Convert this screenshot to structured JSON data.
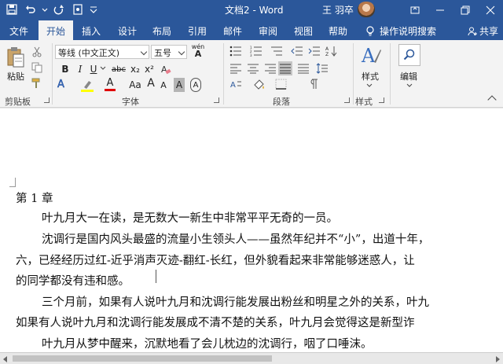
{
  "titlebar": {
    "title": "文档2 - Word",
    "user": "王 羽卒",
    "bg": "#2b579a"
  },
  "tabs": [
    {
      "label": "文件"
    },
    {
      "label": "开始"
    },
    {
      "label": "插入"
    },
    {
      "label": "设计"
    },
    {
      "label": "布局"
    },
    {
      "label": "引用"
    },
    {
      "label": "邮件"
    },
    {
      "label": "审阅"
    },
    {
      "label": "视图"
    },
    {
      "label": "帮助"
    }
  ],
  "tellme": "操作说明搜索",
  "share": "共享",
  "ribbon": {
    "clipboard": {
      "paste": "粘贴",
      "label": "剪贴板"
    },
    "font": {
      "name": "等线 (中文正文)",
      "size": "五号",
      "wen": "wén",
      "wen_a": "A",
      "label": "字体",
      "bold": "B",
      "italic": "I",
      "underline": "U",
      "strike": "abc",
      "sub": "x₂",
      "sup": "x²",
      "font_color": "A",
      "case": "Aa",
      "grow": "A",
      "shrink": "A",
      "char_shading": "A",
      "enclose": "A"
    },
    "paragraph": {
      "label": "段落"
    },
    "styles": {
      "btn": "样式",
      "label": "样式"
    },
    "editing": {
      "btn": "编辑"
    }
  },
  "document": {
    "lines": [
      "第 1 章",
      "叶九月大一在读，是无数大一新生中非常平平无奇的一员。",
      "沈调行是国内风头最盛的流量小生领头人——虽然年纪并不“小”，出道十年，",
      "六，已经经历过红-近乎消声灭迹-翻红-长红，但外貌看起来非常能够迷惑人，让",
      "的同学都没有违和感。",
      "三个月前，如果有人说叶九月和沈调行能发展出粉丝和明星之外的关系，叶九",
      "如果有人说叶九月和沈调行能发展成不清不楚的关系，叶九月会觉得这是新型诈",
      "叶九月从梦中醒来，沉默地看了会儿枕边的沈调行，咽了口唾沫。"
    ]
  }
}
